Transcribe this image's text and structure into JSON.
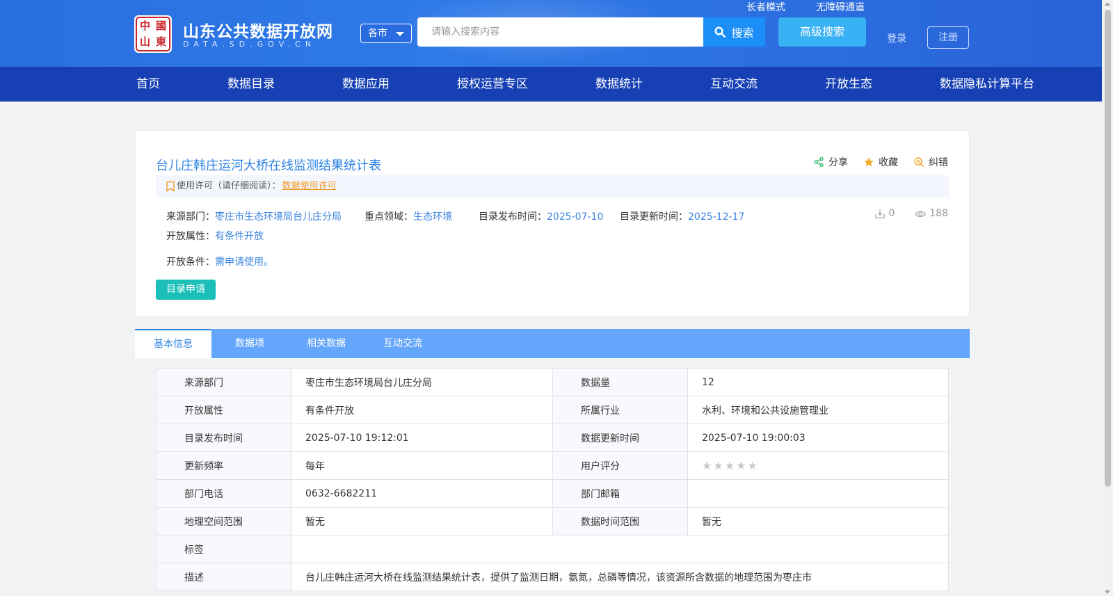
{
  "header": {
    "logo_chars": [
      "中",
      "國",
      "山",
      "東"
    ],
    "site_title": "山东公共数据开放网",
    "site_subtitle": "DATA.SD.GOV.CN",
    "city_select": "各市",
    "search_placeholder": "请输入搜索内容",
    "search_label": "搜索",
    "advanced_search_label": "高级搜索",
    "elder_mode": "长者模式",
    "accessibility": "无障碍通道",
    "login": "登录",
    "register": "注册"
  },
  "nav": [
    "首页",
    "数据目录",
    "数据应用",
    "授权运营专区",
    "数据统计",
    "互动交流",
    "开放生态",
    "数据隐私计算平台"
  ],
  "dataset": {
    "title": "台儿庄韩庄运河大桥在线监测结果统计表",
    "actions": {
      "share": "分享",
      "favorite": "收藏",
      "correct": "纠错"
    },
    "license_label": "使用许可（请仔细阅读）：",
    "license_link": "数据使用许可",
    "source_label": "来源部门：",
    "source_value": "枣庄市生态环境局台儿庄分局",
    "field_label": "重点领域：",
    "field_value": "生态环境",
    "publish_label": "目录发布时间：",
    "publish_value": "2025-07-10",
    "update_label": "目录更新时间：",
    "update_value": "2025-12-17",
    "downloads": "0",
    "views": "188",
    "open_attr_label": "开放属性：",
    "open_attr_value": "有条件开放",
    "open_cond_label": "开放条件：",
    "open_cond_value": "需申请使用。",
    "apply_button": "目录申请"
  },
  "tabs": [
    "基本信息",
    "数据项",
    "相关数据",
    "互动交流"
  ],
  "info_table": {
    "rows": [
      {
        "k1": "来源部门",
        "v1": "枣庄市生态环境局台儿庄分局",
        "k2": "数据量",
        "v2": "12"
      },
      {
        "k1": "开放属性",
        "v1": "有条件开放",
        "k2": "所属行业",
        "v2": "水利、环境和公共设施管理业"
      },
      {
        "k1": "目录发布时间",
        "v1": "2025-07-10 19:12:01",
        "k2": "数据更新时间",
        "v2": "2025-07-10 19:00:03"
      },
      {
        "k1": "更新频率",
        "v1": "每年",
        "k2": "用户评分",
        "v2": ""
      },
      {
        "k1": "部门电话",
        "v1": "0632-6682211",
        "k2": "部门邮箱",
        "v2": ""
      },
      {
        "k1": "地理空间范围",
        "v1": "暂无",
        "k2": "数据时间范围",
        "v2": "暂无"
      }
    ],
    "tags_label": "标签",
    "tags_value": "",
    "desc_label": "描述",
    "desc_value": "台儿庄韩庄运河大桥在线监测结果统计表，提供了监测日期，氨氮，总磷等情况，该资源所含数据的地理范围为枣庄市"
  },
  "rating": {
    "score": 0,
    "max": 5
  },
  "colors": {
    "header": "#2a6fe0",
    "nav": "#1640b4",
    "title_blue": "#2a82e4",
    "link_orange": "#f09a28",
    "apply_teal": "#1bbfb8",
    "tab_bar": "#64a6fb"
  }
}
